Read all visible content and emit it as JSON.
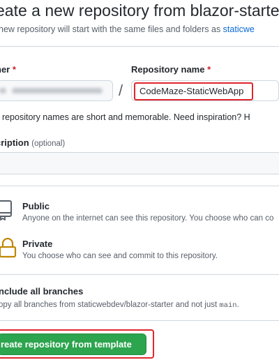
{
  "page": {
    "title": "eate a new repository from blazor-starter",
    "subtitle_prefix": "new repository will start with the same files and folders as ",
    "subtitle_link": "staticwe"
  },
  "form": {
    "owner_label": "ner",
    "required_mark": "*",
    "repo_label": "Repository name",
    "slash": "/",
    "repo_value": "CodeMaze-StaticWebApp",
    "hint": "t repository names are short and memorable. Need inspiration? H",
    "description_label": "cription",
    "description_optional": "(optional)"
  },
  "visibility": {
    "public_title": "Public",
    "public_desc": "Anyone on the internet can see this repository. You choose who can co",
    "private_title": "Private",
    "private_desc": "You choose who can see and commit to this repository."
  },
  "branches": {
    "title": "nclude all branches",
    "desc_prefix": "opy all branches from staticwebdev/blazor-starter and not just ",
    "desc_code": "main",
    "desc_suffix": "."
  },
  "actions": {
    "create_label": "reate repository from template"
  },
  "colors": {
    "accent_green": "#2da44e",
    "highlight_red": "#e0262d",
    "link_blue": "#0969da",
    "required_red": "#cf222e"
  },
  "icons": {
    "public": "repo-icon",
    "private": "lock-icon"
  }
}
